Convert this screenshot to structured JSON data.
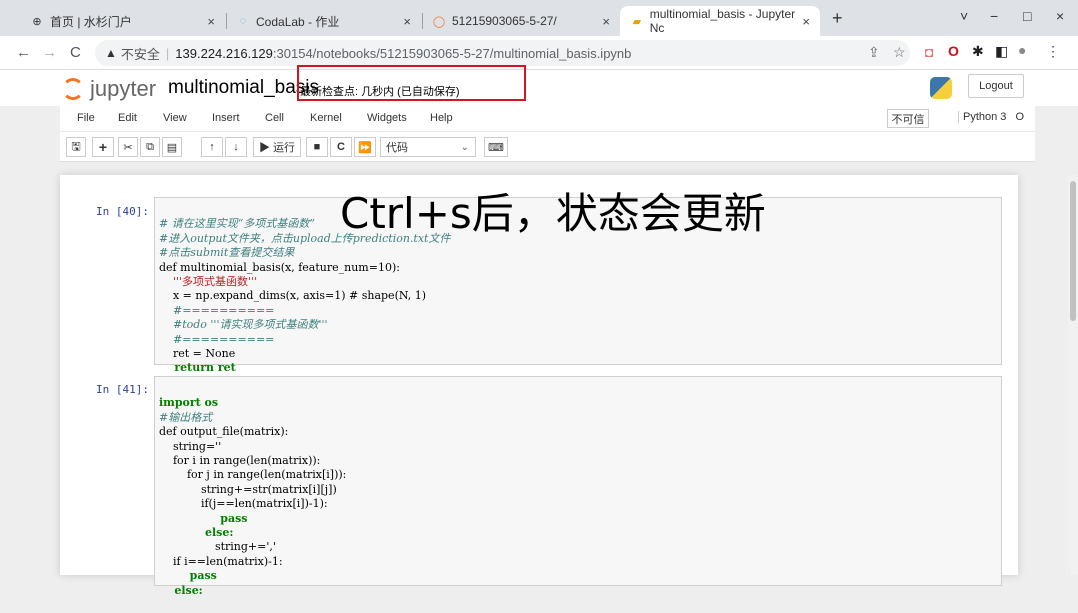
{
  "browser": {
    "tabs": [
      {
        "title": "首页 | 水杉门户",
        "icon": "shuishan-icon",
        "close": "×"
      },
      {
        "title": "CodaLab - 作业",
        "icon": "codalab-icon",
        "close": "×"
      },
      {
        "title": "51215903065-5-27/",
        "icon": "jupyter-tab-icon",
        "close": "×"
      },
      {
        "title": "multinomial_basis - Jupyter Nc",
        "icon": "notebook-tab-icon",
        "close": "×"
      }
    ],
    "new_tab": "+",
    "window_controls": [
      "˅",
      "−",
      "□",
      "×"
    ],
    "address": {
      "security_label": "不安全",
      "host": "139.224.216.129",
      "path": ":30154/notebooks/51215903065-5-27/multinomial_basis.ipynb"
    }
  },
  "jupyter": {
    "logo_text": "jupyter",
    "notebook_name": "multinomial_basis",
    "checkpoint": "最新检查点: 几秒内   (已自动保存)",
    "logout": "Logout",
    "menus": [
      "File",
      "Edit",
      "View",
      "Insert",
      "Cell",
      "Kernel",
      "Widgets",
      "Help"
    ],
    "trusted": "不可信",
    "kernel": "Python 3",
    "toolbar": {
      "run_label": "▶ 运行",
      "cell_type": "代码"
    }
  },
  "annotation": "Ctrl+s后，状态会更新",
  "cells": [
    {
      "prompt": "In  [40]:",
      "lines": [
        "# 请在这里实现“多项式基函数”",
        "#进入output文件夹，点击upload上传prediction.txt文件",
        "#点击submit查看提交结果",
        "def multinomial_basis(x, feature_num=10):",
        "    '''多项式基函数'''",
        "    x = np.expand_dims(x, axis=1) # shape(N, 1)",
        "    #==========",
        "    #todo '''请实现多项式基函数'''",
        "    #==========",
        "    ret = None",
        "    return ret"
      ]
    },
    {
      "prompt": "In  [41]:",
      "lines": [
        "import os",
        "#输出格式",
        "def output_file(matrix):",
        "    string=''",
        "    for i in range(len(matrix)):",
        "        for j in range(len(matrix[i])):",
        "            string+=str(matrix[i][j])",
        "            if(j==len(matrix[i])-1):",
        "                pass",
        "            else:",
        "                string+=','",
        "    if i==len(matrix)-1:",
        "        pass",
        "    else:"
      ]
    }
  ]
}
